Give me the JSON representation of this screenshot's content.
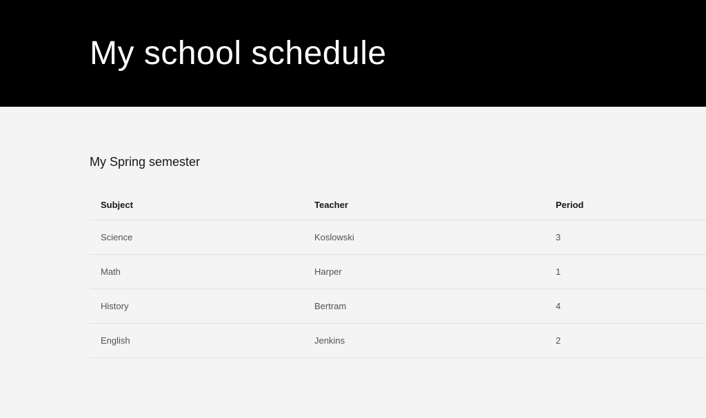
{
  "header": {
    "title": "My school schedule"
  },
  "subtitle": "My Spring semester",
  "table": {
    "headers": {
      "subject": "Subject",
      "teacher": "Teacher",
      "period": "Period"
    },
    "rows": [
      {
        "subject": "Science",
        "teacher": "Koslowski",
        "period": "3"
      },
      {
        "subject": "Math",
        "teacher": "Harper",
        "period": "1"
      },
      {
        "subject": "History",
        "teacher": "Bertram",
        "period": "4"
      },
      {
        "subject": "English",
        "teacher": "Jenkins",
        "period": "2"
      }
    ]
  }
}
